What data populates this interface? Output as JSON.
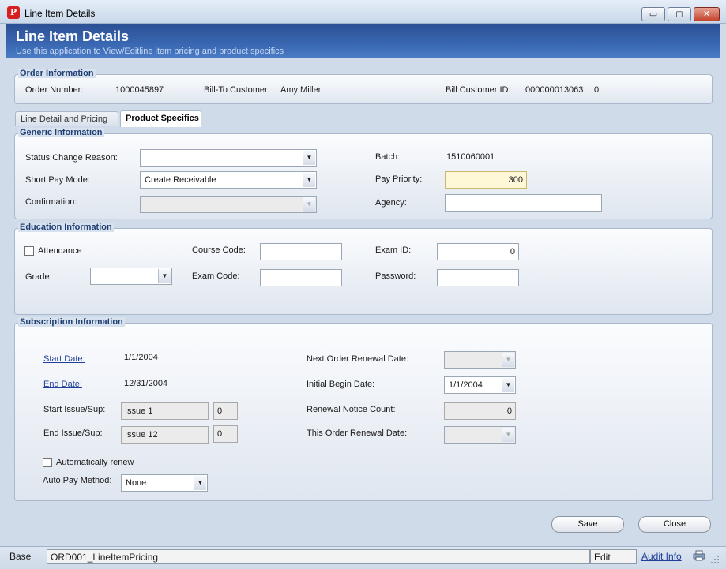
{
  "window": {
    "title": "Line Item Details",
    "app_icon_glyph": "P",
    "controls": {
      "minimize": "▭",
      "maximize": "◻",
      "close": "✕"
    }
  },
  "banner": {
    "title": "Line Item Details",
    "subtitle": "Use this application to View/Editline item pricing and product specifics"
  },
  "order_info": {
    "legend": "Order Information",
    "order_number_label": "Order Number:",
    "order_number": "1000045897",
    "bill_to_label": "Bill-To Customer:",
    "bill_to": "Amy Miller",
    "bill_customer_id_label": "Bill Customer ID:",
    "bill_customer_id": "000000013063",
    "bill_customer_suffix": "0"
  },
  "tabs": [
    {
      "label": "Line Detail and Pricing",
      "active": false
    },
    {
      "label": "Product Specifics",
      "active": true
    }
  ],
  "generic": {
    "legend": "Generic Information",
    "status_change_reason_label": "Status Change Reason:",
    "status_change_reason": "",
    "short_pay_mode_label": "Short Pay Mode:",
    "short_pay_mode": "Create Receivable",
    "confirmation_label": "Confirmation:",
    "confirmation": "",
    "batch_label": "Batch:",
    "batch": "1510060001",
    "pay_priority_label": "Pay Priority:",
    "pay_priority": "300",
    "agency_label": "Agency:",
    "agency": ""
  },
  "education": {
    "legend": "Education Information",
    "attendance_label": "Attendance",
    "attendance_checked": false,
    "grade_label": "Grade:",
    "grade": "",
    "course_code_label": "Course Code:",
    "course_code": "",
    "exam_code_label": "Exam Code:",
    "exam_code": "",
    "exam_id_label": "Exam ID:",
    "exam_id": "0",
    "password_label": "Password:",
    "password": ""
  },
  "subscription": {
    "legend": "Subscription Information",
    "start_date_label": "Start Date:",
    "start_date": "1/1/2004",
    "end_date_label": "End Date:",
    "end_date": "12/31/2004",
    "start_issue_label": "Start Issue/Sup:",
    "start_issue": "Issue 1",
    "start_issue_sup": "0",
    "end_issue_label": "End Issue/Sup:",
    "end_issue": "Issue 12",
    "end_issue_sup": "0",
    "auto_renew_label": "Automatically renew",
    "auto_renew_checked": false,
    "auto_pay_method_label": "Auto Pay Method:",
    "auto_pay_method": "None",
    "next_order_renewal_label": "Next Order Renewal Date:",
    "next_order_renewal": "",
    "initial_begin_label": "Initial Begin Date:",
    "initial_begin": "1/1/2004",
    "renewal_notice_count_label": "Renewal Notice Count:",
    "renewal_notice_count": "0",
    "this_order_renewal_label": "This Order Renewal Date:",
    "this_order_renewal": ""
  },
  "buttons": {
    "save": "Save",
    "close": "Close"
  },
  "statusbar": {
    "base": "Base",
    "form_name": "ORD001_LineItemPricing",
    "mode": "Edit",
    "audit_info": "Audit Info"
  }
}
